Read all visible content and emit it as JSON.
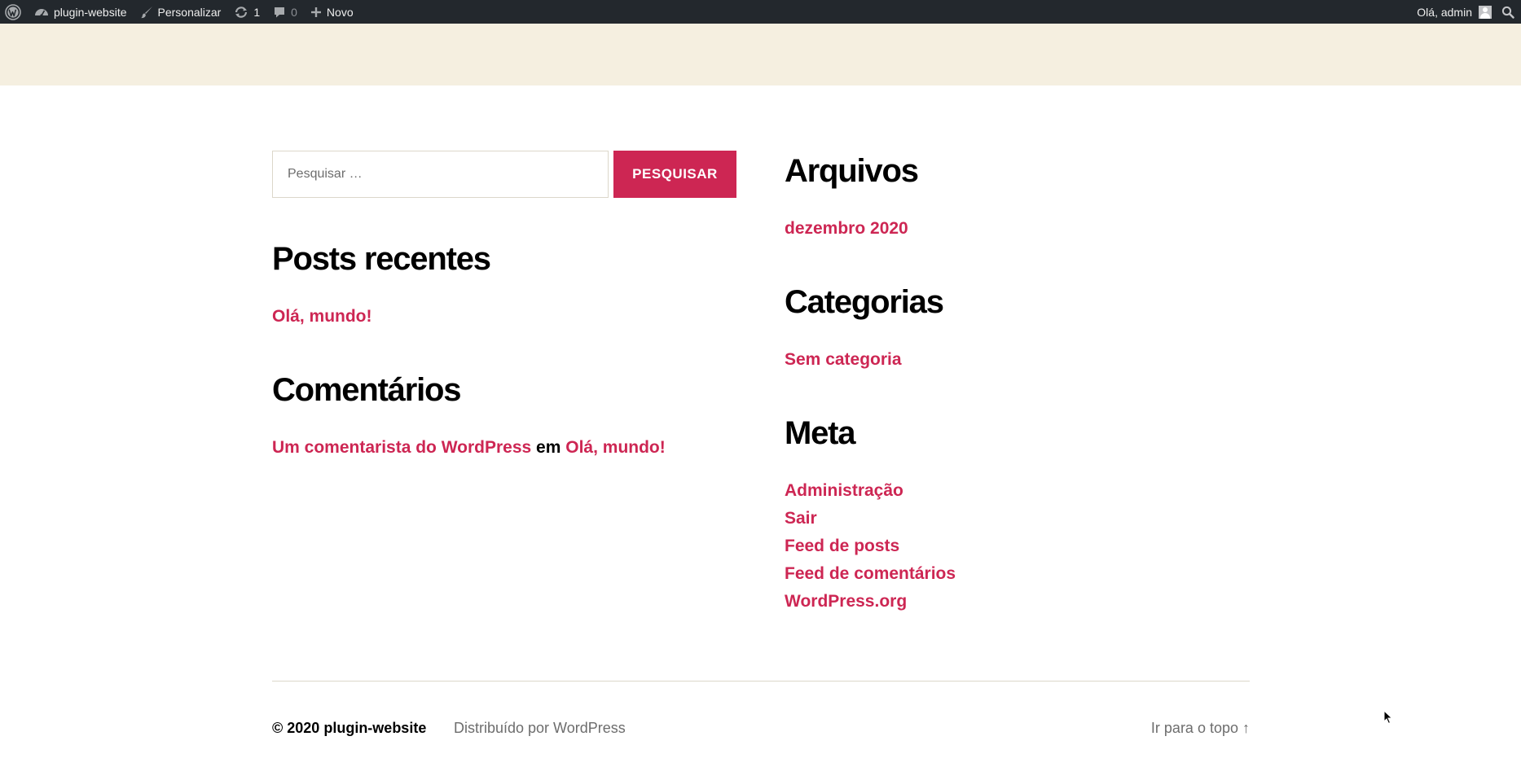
{
  "adminbar": {
    "site_name": "plugin-website",
    "customize_label": "Personalizar",
    "updates_count": "1",
    "comments_count": "0",
    "new_label": "Novo",
    "greeting": "Olá, admin"
  },
  "search": {
    "placeholder": "Pesquisar …",
    "button_label": "PESQUISAR"
  },
  "recent_posts": {
    "title": "Posts recentes",
    "items": [
      "Olá, mundo!"
    ]
  },
  "comments": {
    "title": "Comentários",
    "author": "Um comentarista do WordPress",
    "connector": "em",
    "post": "Olá, mundo!"
  },
  "archives": {
    "title": "Arquivos",
    "items": [
      "dezembro 2020"
    ]
  },
  "categories": {
    "title": "Categorias",
    "items": [
      "Sem categoria"
    ]
  },
  "meta": {
    "title": "Meta",
    "items": [
      "Administração",
      "Sair",
      "Feed de posts",
      "Feed de comentários",
      "WordPress.org"
    ]
  },
  "footer": {
    "copyright_prefix": "© 2020",
    "site_name": "plugin-website",
    "powered_by": "Distribuído por WordPress",
    "to_top": "Ir para o topo ↑"
  },
  "colors": {
    "admin_bar": "#23282d",
    "header_band": "#f5efe0",
    "accent": "#cd2653"
  }
}
